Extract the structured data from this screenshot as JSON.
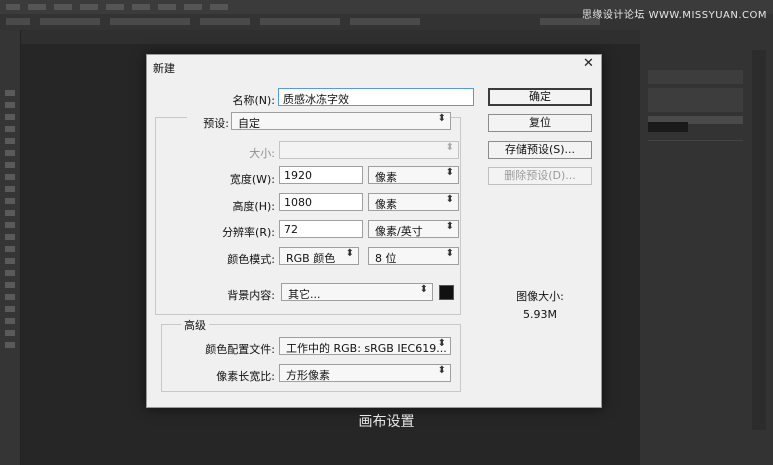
{
  "watermark": "思缘设计论坛 WWW.MISSYUAN.COM",
  "dialog": {
    "title": "新建",
    "close_glyph": "✕",
    "name": {
      "label": "名称(N):",
      "value": "质感冰冻字效"
    },
    "preset": {
      "label": "预设:",
      "value": "自定"
    },
    "size": {
      "label": "大小:",
      "value": ""
    },
    "width": {
      "label": "宽度(W):",
      "value": "1920",
      "unit": "像素"
    },
    "height": {
      "label": "高度(H):",
      "value": "1080",
      "unit": "像素"
    },
    "resolution": {
      "label": "分辨率(R):",
      "value": "72",
      "unit": "像素/英寸"
    },
    "color_mode": {
      "label": "颜色模式:",
      "value": "RGB 颜色",
      "depth": "8 位"
    },
    "background": {
      "label": "背景内容:",
      "value": "其它...",
      "swatch_color": "#111111"
    },
    "advanced": {
      "title": "高级",
      "color_profile": {
        "label": "颜色配置文件:",
        "value": "工作中的 RGB: sRGB IEC619..."
      },
      "pixel_aspect": {
        "label": "像素长宽比:",
        "value": "方形像素"
      }
    },
    "buttons": {
      "ok": "确定",
      "reset": "复位",
      "save_preset": "存储预设(S)...",
      "delete_preset": "删除预设(D)..."
    },
    "image_size": {
      "label": "图像大小:",
      "value": "5.93M"
    }
  },
  "caption": "画布设置",
  "arrow_glyph": "⬍"
}
